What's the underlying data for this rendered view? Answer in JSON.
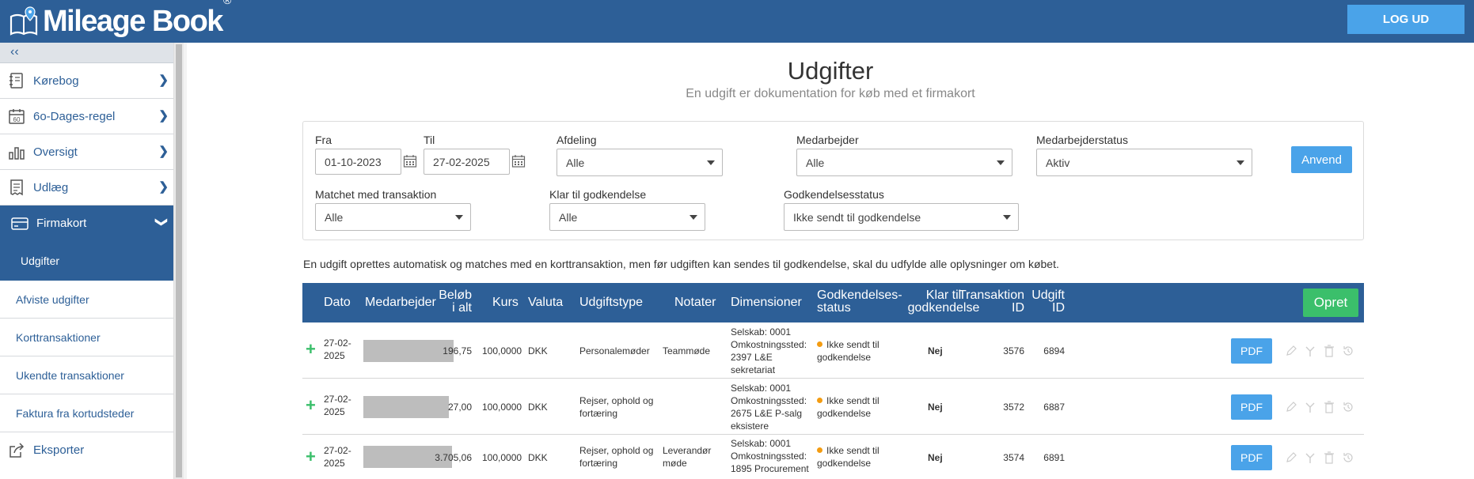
{
  "header": {
    "brand": "Mileage Book",
    "brand_mark": "®",
    "logout_label": "LOG UD"
  },
  "sidebar": {
    "collapse_label": "‹‹",
    "items": [
      {
        "label": "Kørebog",
        "icon": "logbook-icon"
      },
      {
        "label": "6o-Dages-regel",
        "icon": "calendar-60-icon"
      },
      {
        "label": "Oversigt",
        "icon": "bar-chart-icon"
      },
      {
        "label": "Udlæg",
        "icon": "receipt-icon"
      },
      {
        "label": "Firmakort",
        "icon": "credit-card-icon"
      }
    ],
    "subitems": [
      {
        "label": "Udgifter"
      },
      {
        "label": "Afviste udgifter"
      },
      {
        "label": "Korttransaktioner"
      },
      {
        "label": "Ukendte transaktioner"
      },
      {
        "label": "Faktura fra kortudsteder"
      }
    ],
    "export_label": "Eksporter"
  },
  "page": {
    "title": "Udgifter",
    "subtitle": "En udgift er dokumentation for køb med et firmakort",
    "info": "En udgift oprettes automatisk og matches med en korttransaktion, men før udgiften kan sendes til godkendelse, skal du udfylde alle oplysninger om købet."
  },
  "filters": {
    "from_label": "Fra",
    "from_value": "01-10-2023",
    "to_label": "Til",
    "to_value": "27-02-2025",
    "department_label": "Afdeling",
    "department_value": "Alle",
    "employee_label": "Medarbejder",
    "employee_value": "Alle",
    "employee_status_label": "Medarbejderstatus",
    "employee_status_value": "Aktiv",
    "apply_label": "Anvend",
    "matched_label": "Matchet med transaktion",
    "matched_value": "Alle",
    "ready_label": "Klar til godkendelse",
    "ready_value": "Alle",
    "approval_label": "Godkendelsesstatus",
    "approval_value": "Ikke sendt til godkendelse"
  },
  "table": {
    "headers": {
      "date": "Dato",
      "employee": "Medarbejder",
      "amount_1": "Beløb",
      "amount_2": "i alt",
      "rate": "Kurs",
      "currency": "Valuta",
      "type": "Udgiftstype",
      "notes": "Notater",
      "dimensions": "Dimensioner",
      "approval_1": "Godkendelses-",
      "approval_2": "status",
      "ready_1": "Klar til",
      "ready_2": "godkendelse",
      "tx_1": "Transaktion",
      "tx_2": "ID",
      "exp_1": "Udgift",
      "exp_2": "ID"
    },
    "create_label": "Opret",
    "rows": [
      {
        "date_1": "27-02-",
        "date_2": "2025",
        "amount": "196,75",
        "rate": "100,0000",
        "currency": "DKK",
        "type_1": "Personalemøder",
        "type_2": "",
        "notes_1": "Teammøde",
        "notes_2": "",
        "dim_1": "Selskab: 0001",
        "dim_2": "Omkostningssted:",
        "dim_3": "2397 L&E",
        "dim_4": "sekretariat",
        "status_1": "Ikke sendt til",
        "status_2": "godkendelse",
        "ready": "Nej",
        "tx_id": "3576",
        "exp_id": "6894",
        "pdf": "PDF"
      },
      {
        "date_1": "27-02-",
        "date_2": "2025",
        "amount": "27,00",
        "rate": "100,0000",
        "currency": "DKK",
        "type_1": "Rejser, ophold og",
        "type_2": "fortæring",
        "notes_1": "",
        "notes_2": "",
        "dim_1": "Selskab: 0001",
        "dim_2": "Omkostningssted:",
        "dim_3": "2675 L&E P-salg",
        "dim_4": "eksistere",
        "status_1": "Ikke sendt til",
        "status_2": "godkendelse",
        "ready": "Nej",
        "tx_id": "3572",
        "exp_id": "6887",
        "pdf": "PDF"
      },
      {
        "date_1": "27-02-",
        "date_2": "2025",
        "amount": "3.705,06",
        "rate": "100,0000",
        "currency": "DKK",
        "type_1": "Rejser, ophold og",
        "type_2": "fortæring",
        "notes_1": "Leverandør",
        "notes_2": "møde",
        "dim_1": "Selskab: 0001",
        "dim_2": "Omkostningssted:",
        "dim_3": "1895 Procurement",
        "dim_4": "",
        "status_1": "Ikke sendt til",
        "status_2": "godkendelse",
        "ready": "Nej",
        "tx_id": "3574",
        "exp_id": "6891",
        "pdf": "PDF"
      }
    ]
  },
  "colors": {
    "primary": "#2d5f97",
    "accent": "#4aa3e9",
    "create": "#3bbf6b",
    "status_dot": "#f39c12"
  }
}
